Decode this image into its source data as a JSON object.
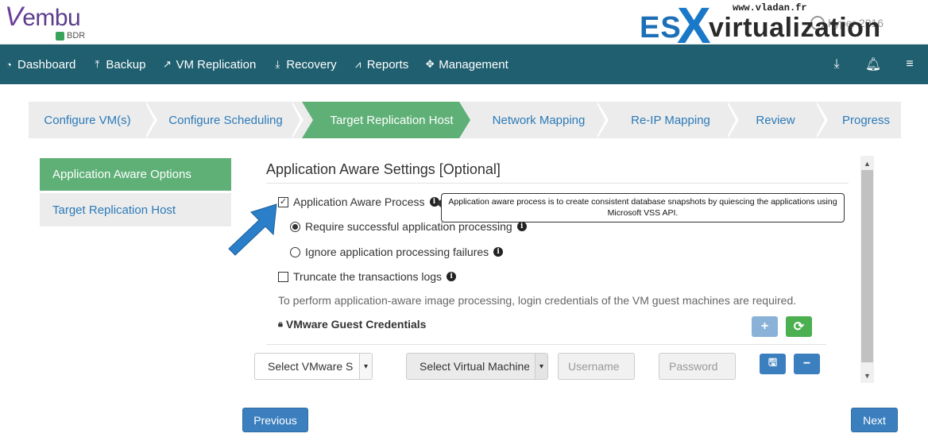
{
  "brand": {
    "logo_text": "embu",
    "logo_letter": "V",
    "logo_sub": "BDR",
    "accent_green": "#5fb077",
    "nav_bg": "#1f5f6f",
    "link_blue": "#2b7ab8",
    "button_blue": "#3b7fbf"
  },
  "watermark": {
    "url": "www.vladan.fr",
    "es": "ES",
    "x": "X",
    "rest": "virtualization"
  },
  "user": {
    "name": "hyper 2016",
    "icon": "user-icon"
  },
  "nav": {
    "items": [
      {
        "label": "Dashboard",
        "icon": "dashboard-icon"
      },
      {
        "label": "Backup",
        "icon": "upload-icon"
      },
      {
        "label": "VM Replication",
        "icon": "share-icon"
      },
      {
        "label": "Recovery",
        "icon": "download-icon"
      },
      {
        "label": "Reports",
        "icon": "chart-icon"
      },
      {
        "label": "Management",
        "icon": "crosshair-icon"
      }
    ],
    "right_icons": [
      "download-icon",
      "bell-icon",
      "menu-icon"
    ]
  },
  "steps": [
    {
      "label": "Configure VM(s)"
    },
    {
      "label": "Configure Scheduling"
    },
    {
      "label": "Target Replication Host",
      "active": true
    },
    {
      "label": "Network Mapping"
    },
    {
      "label": "Re-IP Mapping"
    },
    {
      "label": "Review"
    },
    {
      "label": "Progress"
    }
  ],
  "sidebar": {
    "items": [
      {
        "label": "Application Aware Options",
        "active": true
      },
      {
        "label": "Target Replication Host"
      }
    ]
  },
  "main": {
    "title": "Application Aware Settings [Optional]",
    "app_aware_label": "Application Aware Process",
    "app_aware_checked": true,
    "tooltip": "Application aware process is to create consistent database snapshots by quiescing the applications using Microsoft VSS API.",
    "radio_require": "Require successful application processing",
    "radio_ignore": "Ignore application processing failures",
    "truncate_label": "Truncate the transactions logs",
    "note": "To perform application-aware image processing, login credentials of the VM guest machines are required.",
    "cred_title": "VMware Guest Credentials"
  },
  "creds_row": {
    "select_server": "Select VMware S",
    "select_vm": "Select Virtual Machine",
    "username_placeholder": "Username",
    "password_placeholder": "Password"
  },
  "footer": {
    "previous": "Previous",
    "next": "Next"
  }
}
